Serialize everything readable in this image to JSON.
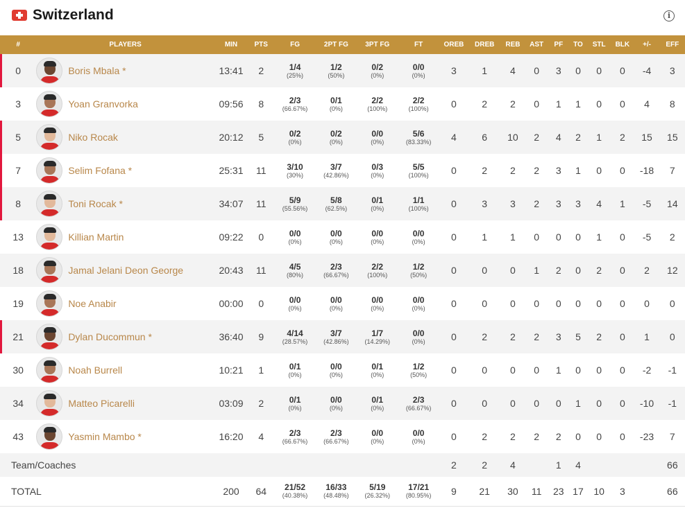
{
  "team": {
    "name": "Switzerland",
    "flag_icon": "swiss-flag-icon",
    "info_icon": "info-icon",
    "info_glyph": "i"
  },
  "colors": {
    "header_bg": "#c2923c",
    "starter_marker": "#e2173d",
    "player_link": "#b8874a"
  },
  "columns": [
    "#",
    "PLAYERS",
    "MIN",
    "PTS",
    "FG",
    "2PT FG",
    "3PT FG",
    "FT",
    "OREB",
    "DREB",
    "REB",
    "AST",
    "PF",
    "TO",
    "STL",
    "BLK",
    "+/-",
    "EFF"
  ],
  "players": [
    {
      "num": "0",
      "name": "Boris Mbala *",
      "starter": true,
      "min": "13:41",
      "pts": "2",
      "fg": "1/4",
      "fg_pct": "(25%)",
      "pt2": "1/2",
      "pt2_pct": "(50%)",
      "pt3": "0/2",
      "pt3_pct": "(0%)",
      "ft": "0/0",
      "ft_pct": "(0%)",
      "oreb": "3",
      "dreb": "1",
      "reb": "4",
      "ast": "0",
      "pf": "3",
      "to": "0",
      "stl": "0",
      "blk": "0",
      "pm": "-4",
      "eff": "3"
    },
    {
      "num": "3",
      "name": "Yoan Granvorka",
      "starter": false,
      "min": "09:56",
      "pts": "8",
      "fg": "2/3",
      "fg_pct": "(66.67%)",
      "pt2": "0/1",
      "pt2_pct": "(0%)",
      "pt3": "2/2",
      "pt3_pct": "(100%)",
      "ft": "2/2",
      "ft_pct": "(100%)",
      "oreb": "0",
      "dreb": "2",
      "reb": "2",
      "ast": "0",
      "pf": "1",
      "to": "1",
      "stl": "0",
      "blk": "0",
      "pm": "4",
      "eff": "8"
    },
    {
      "num": "5",
      "name": "Niko Rocak",
      "starter": true,
      "min": "20:12",
      "pts": "5",
      "fg": "0/2",
      "fg_pct": "(0%)",
      "pt2": "0/2",
      "pt2_pct": "(0%)",
      "pt3": "0/0",
      "pt3_pct": "(0%)",
      "ft": "5/6",
      "ft_pct": "(83.33%)",
      "oreb": "4",
      "dreb": "6",
      "reb": "10",
      "ast": "2",
      "pf": "4",
      "to": "2",
      "stl": "1",
      "blk": "2",
      "pm": "15",
      "eff": "15"
    },
    {
      "num": "7",
      "name": "Selim Fofana *",
      "starter": true,
      "min": "25:31",
      "pts": "11",
      "fg": "3/10",
      "fg_pct": "(30%)",
      "pt2": "3/7",
      "pt2_pct": "(42.86%)",
      "pt3": "0/3",
      "pt3_pct": "(0%)",
      "ft": "5/5",
      "ft_pct": "(100%)",
      "oreb": "0",
      "dreb": "2",
      "reb": "2",
      "ast": "2",
      "pf": "3",
      "to": "1",
      "stl": "0",
      "blk": "0",
      "pm": "-18",
      "eff": "7"
    },
    {
      "num": "8",
      "name": "Toni Rocak *",
      "starter": true,
      "min": "34:07",
      "pts": "11",
      "fg": "5/9",
      "fg_pct": "(55.56%)",
      "pt2": "5/8",
      "pt2_pct": "(62.5%)",
      "pt3": "0/1",
      "pt3_pct": "(0%)",
      "ft": "1/1",
      "ft_pct": "(100%)",
      "oreb": "0",
      "dreb": "3",
      "reb": "3",
      "ast": "2",
      "pf": "3",
      "to": "3",
      "stl": "4",
      "blk": "1",
      "pm": "-5",
      "eff": "14"
    },
    {
      "num": "13",
      "name": "Killian Martin",
      "starter": false,
      "min": "09:22",
      "pts": "0",
      "fg": "0/0",
      "fg_pct": "(0%)",
      "pt2": "0/0",
      "pt2_pct": "(0%)",
      "pt3": "0/0",
      "pt3_pct": "(0%)",
      "ft": "0/0",
      "ft_pct": "(0%)",
      "oreb": "0",
      "dreb": "1",
      "reb": "1",
      "ast": "0",
      "pf": "0",
      "to": "0",
      "stl": "1",
      "blk": "0",
      "pm": "-5",
      "eff": "2"
    },
    {
      "num": "18",
      "name": "Jamal Jelani Deon George",
      "starter": false,
      "min": "20:43",
      "pts": "11",
      "fg": "4/5",
      "fg_pct": "(80%)",
      "pt2": "2/3",
      "pt2_pct": "(66.67%)",
      "pt3": "2/2",
      "pt3_pct": "(100%)",
      "ft": "1/2",
      "ft_pct": "(50%)",
      "oreb": "0",
      "dreb": "0",
      "reb": "0",
      "ast": "1",
      "pf": "2",
      "to": "0",
      "stl": "2",
      "blk": "0",
      "pm": "2",
      "eff": "12"
    },
    {
      "num": "19",
      "name": "Noe Anabir",
      "starter": false,
      "min": "00:00",
      "pts": "0",
      "fg": "0/0",
      "fg_pct": "(0%)",
      "pt2": "0/0",
      "pt2_pct": "(0%)",
      "pt3": "0/0",
      "pt3_pct": "(0%)",
      "ft": "0/0",
      "ft_pct": "(0%)",
      "oreb": "0",
      "dreb": "0",
      "reb": "0",
      "ast": "0",
      "pf": "0",
      "to": "0",
      "stl": "0",
      "blk": "0",
      "pm": "0",
      "eff": "0"
    },
    {
      "num": "21",
      "name": "Dylan Ducommun *",
      "starter": true,
      "min": "36:40",
      "pts": "9",
      "fg": "4/14",
      "fg_pct": "(28.57%)",
      "pt2": "3/7",
      "pt2_pct": "(42.86%)",
      "pt3": "1/7",
      "pt3_pct": "(14.29%)",
      "ft": "0/0",
      "ft_pct": "(0%)",
      "oreb": "0",
      "dreb": "2",
      "reb": "2",
      "ast": "2",
      "pf": "3",
      "to": "5",
      "stl": "2",
      "blk": "0",
      "pm": "1",
      "eff": "0"
    },
    {
      "num": "30",
      "name": "Noah Burrell",
      "starter": false,
      "min": "10:21",
      "pts": "1",
      "fg": "0/1",
      "fg_pct": "(0%)",
      "pt2": "0/0",
      "pt2_pct": "(0%)",
      "pt3": "0/1",
      "pt3_pct": "(0%)",
      "ft": "1/2",
      "ft_pct": "(50%)",
      "oreb": "0",
      "dreb": "0",
      "reb": "0",
      "ast": "0",
      "pf": "1",
      "to": "0",
      "stl": "0",
      "blk": "0",
      "pm": "-2",
      "eff": "-1"
    },
    {
      "num": "34",
      "name": "Matteo Picarelli",
      "starter": false,
      "min": "03:09",
      "pts": "2",
      "fg": "0/1",
      "fg_pct": "(0%)",
      "pt2": "0/0",
      "pt2_pct": "(0%)",
      "pt3": "0/1",
      "pt3_pct": "(0%)",
      "ft": "2/3",
      "ft_pct": "(66.67%)",
      "oreb": "0",
      "dreb": "0",
      "reb": "0",
      "ast": "0",
      "pf": "0",
      "to": "1",
      "stl": "0",
      "blk": "0",
      "pm": "-10",
      "eff": "-1"
    },
    {
      "num": "43",
      "name": "Yasmin Mambo *",
      "starter": false,
      "min": "16:20",
      "pts": "4",
      "fg": "2/3",
      "fg_pct": "(66.67%)",
      "pt2": "2/3",
      "pt2_pct": "(66.67%)",
      "pt3": "0/0",
      "pt3_pct": "(0%)",
      "ft": "0/0",
      "ft_pct": "(0%)",
      "oreb": "0",
      "dreb": "2",
      "reb": "2",
      "ast": "2",
      "pf": "2",
      "to": "0",
      "stl": "0",
      "blk": "0",
      "pm": "-23",
      "eff": "7"
    }
  ],
  "coaches": {
    "label": "Team/Coaches",
    "oreb": "2",
    "dreb": "2",
    "reb": "4",
    "pf": "1",
    "to": "4",
    "eff": "66"
  },
  "total": {
    "label": "TOTAL",
    "min": "200",
    "pts": "64",
    "fg": "21/52",
    "fg_pct": "(40.38%)",
    "pt2": "16/33",
    "pt2_pct": "(48.48%)",
    "pt3": "5/19",
    "pt3_pct": "(26.32%)",
    "ft": "17/21",
    "ft_pct": "(80.95%)",
    "oreb": "9",
    "dreb": "21",
    "reb": "30",
    "ast": "11",
    "pf": "23",
    "to": "17",
    "stl": "10",
    "blk": "3",
    "eff": "66"
  }
}
